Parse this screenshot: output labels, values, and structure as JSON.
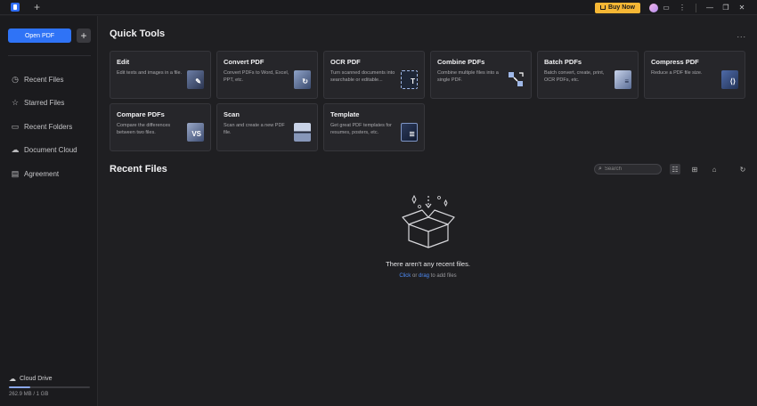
{
  "titlebar": {
    "new_tab": "+",
    "buy_now": "Buy Now"
  },
  "sidebar": {
    "open_pdf": "Open PDF",
    "add": "+",
    "items": [
      {
        "label": "Recent Files",
        "icon": "clock-icon"
      },
      {
        "label": "Starred Files",
        "icon": "star-icon"
      },
      {
        "label": "Recent Folders",
        "icon": "folder-icon"
      },
      {
        "label": "Document Cloud",
        "icon": "cloud-icon"
      },
      {
        "label": "Agreement",
        "icon": "document-icon"
      }
    ],
    "cloud_drive": "Cloud Drive",
    "storage_text": "262.9 MB / 1 GB",
    "storage_fraction": 0.26
  },
  "quick_tools": {
    "title": "Quick Tools",
    "more": "...",
    "cards": [
      {
        "title": "Edit",
        "desc": "Edit texts and images in a file."
      },
      {
        "title": "Convert PDF",
        "desc": "Convert PDFs to Word, Excel, PPT, etc."
      },
      {
        "title": "OCR PDF",
        "desc": "Turn scanned documents into searchable or editable..."
      },
      {
        "title": "Combine PDFs",
        "desc": "Combine multiple files into a single PDF."
      },
      {
        "title": "Batch PDFs",
        "desc": "Batch convert, create, print, OCR PDFs, etc."
      },
      {
        "title": "Compress PDF",
        "desc": "Reduce a PDF file size."
      },
      {
        "title": "Compare PDFs",
        "desc": "Compare the differences between two files."
      },
      {
        "title": "Scan",
        "desc": "Scan and create a new PDF file."
      },
      {
        "title": "Template",
        "desc": "Get great PDF templates for resumes, posters, etc."
      }
    ]
  },
  "recent_files": {
    "title": "Recent Files",
    "search_placeholder": "Search",
    "empty_message": "There aren't any recent files.",
    "sub_click": "Click",
    "sub_or": " or ",
    "sub_drag": "drag",
    "sub_rest": " to add files"
  }
}
